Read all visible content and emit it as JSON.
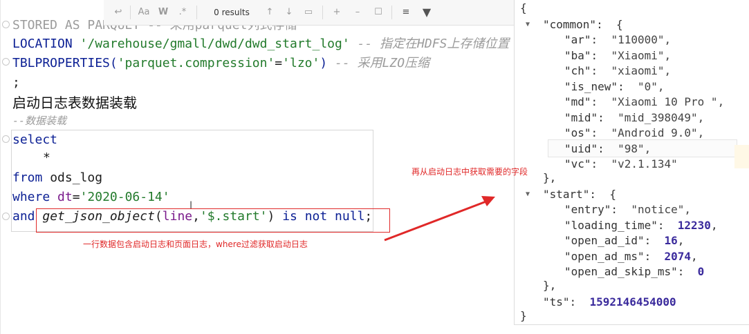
{
  "find_bar": {
    "results": "0 results",
    "match_case": "Aa",
    "words": "W",
    "regex": ".*"
  },
  "code": {
    "line1": "STORED AS PARQUET -- 采用parquet列式存储",
    "line2_kw": "LOCATION",
    "line2_str": "'/warehouse/gmall/dwd/dwd_start_log'",
    "line2_cm": "-- 指定在HDFS上存储位置",
    "line3_a": "TBLPROPERTIES(",
    "line3_str1": "'parquet.compression'",
    "line3_eq": "=",
    "line3_str2": "'lzo'",
    "line3_b": ")",
    "line3_cm": "-- 采用LZO压缩",
    "line4": ";",
    "heading": "启动日志表数据装载",
    "comment": "--数据装载",
    "select": "select",
    "star": "*",
    "from_kw": "from",
    "from_tbl": "ods_log",
    "where_kw": "where",
    "where_field": "dt",
    "where_eq": "=",
    "where_val": "'2020-06-14'",
    "and_kw": "and",
    "fn_name": "get_json_object",
    "fn_open": "(",
    "fn_param": "line",
    "fn_comma": ",",
    "fn_path": "'$.start'",
    "fn_close": ")",
    "fn_tail": "is not null",
    "fn_semi": ";"
  },
  "annotations": {
    "right_note": "再从启动日志中获取需要的字段",
    "bottom_note": "一行数据包含启动日志和页面日志，where过滤获取启动日志"
  },
  "json_view": {
    "open_brace": "{",
    "common_key": "\"common\":",
    "common_open": "{",
    "common": [
      {
        "k": "\"ar\":",
        "v": "\"110000\","
      },
      {
        "k": "\"ba\":",
        "v": "\"Xiaomi\","
      },
      {
        "k": "\"ch\":",
        "v": "\"xiaomi\","
      },
      {
        "k": "\"is_new\":",
        "v": "\"0\","
      },
      {
        "k": "\"md\":",
        "v": "\"Xiaomi 10 Pro \","
      },
      {
        "k": "\"mid\":",
        "v": "\"mid_398049\","
      },
      {
        "k": "\"os\":",
        "v": "\"Android 9.0\","
      },
      {
        "k": "\"uid\":",
        "v": "\"98\","
      },
      {
        "k": "\"vc\":",
        "v": "\"v2.1.134\""
      }
    ],
    "common_close": "},",
    "start_key": "\"start\":",
    "start_open": "{",
    "start": [
      {
        "k": "\"entry\":",
        "v": "\"notice\",",
        "num": false
      },
      {
        "k": "\"loading_time\":",
        "v": "12230",
        "tail": ",",
        "num": true
      },
      {
        "k": "\"open_ad_id\":",
        "v": "16",
        "tail": ",",
        "num": true
      },
      {
        "k": "\"open_ad_ms\":",
        "v": "2074",
        "tail": ",",
        "num": true
      },
      {
        "k": "\"open_ad_skip_ms\":",
        "v": "0",
        "tail": "",
        "num": true
      }
    ],
    "start_close": "},",
    "ts_key": "\"ts\":",
    "ts_val": "1592146454000",
    "close_brace": "}"
  }
}
